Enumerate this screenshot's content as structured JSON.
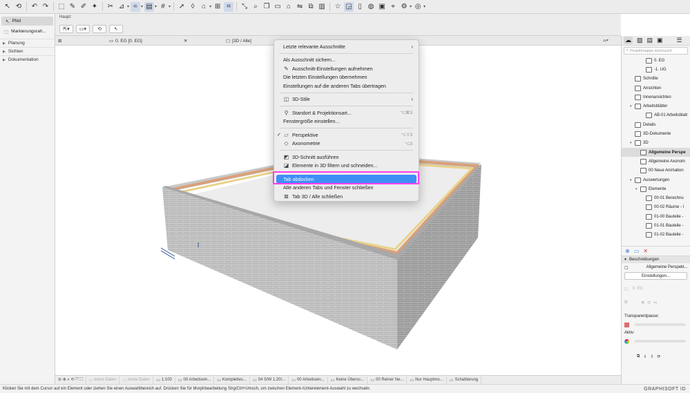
{
  "toolbar": {
    "colors": {
      "background": "#ececec",
      "active": "#cfd9ea"
    },
    "icons": [
      "undo-icon",
      "redo-icon",
      "arrow-tool-icon",
      "pen-icon",
      "magic-wand-icon",
      "scissors-icon",
      "measure-icon",
      "layer-icon",
      "grid-icon",
      "snap-icon",
      "cursor-icon",
      "lock-icon",
      "star-icon",
      "window-icon",
      "settings-icon"
    ]
  },
  "infobar": {
    "label": "Haupt:"
  },
  "left_panel": {
    "tools": [
      {
        "label": "Pfeil",
        "selected": true
      },
      {
        "label": "Markierungsrah...",
        "selected": false
      }
    ],
    "nav": [
      "Planung",
      "Sichten",
      "Dokumentation"
    ]
  },
  "tabs": {
    "tab1": "0. EG [0. EG]",
    "tab2": "[3D / Alle]"
  },
  "menu": {
    "items": {
      "letzte": "Letzte relevante Ausschnitte",
      "speichern": "Als Ausschnitt sichern...",
      "aufnehmen": "Ausschnitt-Einstellungen aufnehmen",
      "uebernehmen": "Die letzten Einstellungen übernehmen",
      "uebertragen": "Einstellungen auf die anderen Tabs übertragen",
      "stile": "3D-Stile",
      "standort": "Standort & Projektionsart...",
      "standort_sc": "⌥⌘3",
      "fenster": "Fenstergröße einstellen...",
      "perspektive": "Perspektive",
      "perspektive_sc": "⌥⇧3",
      "axonometrie": "Axonometrie",
      "axonometrie_sc": "⌥3",
      "schnitt": "3D-Schnitt ausführen",
      "filtern": "Elemente in 3D filtern und schneiden...",
      "abdocken": "Tab abdocken",
      "alle_schliessen": "Alle anderen Tabs und Fenster schließen",
      "tab_schliessen": "Tab 3D / Alle schließen"
    },
    "highlight_color": "#3e8ef7",
    "outline_color": "#ff3cf0"
  },
  "right_panel": {
    "search_placeholder": "Projektmappe durchsuch",
    "tree": [
      {
        "label": "0. EG",
        "indent": 3
      },
      {
        "label": "-1. UG",
        "indent": 3
      },
      {
        "label": "Schnitte",
        "indent": 1
      },
      {
        "label": "Ansichten",
        "indent": 1
      },
      {
        "label": "Innenansichten",
        "indent": 1
      },
      {
        "label": "Arbeitsblätter",
        "indent": 1,
        "expanded": true
      },
      {
        "label": "AB-01 Arbeitsblatt",
        "indent": 3
      },
      {
        "label": "Details",
        "indent": 1
      },
      {
        "label": "3D-Dokumente",
        "indent": 1
      },
      {
        "label": "3D",
        "indent": 1,
        "expanded": true
      },
      {
        "label": "Allgemeine Perspe",
        "indent": 2,
        "selected": true
      },
      {
        "label": "Allgemeine Axonom",
        "indent": 2
      },
      {
        "label": "00 Neue Animation",
        "indent": 2
      },
      {
        "label": "Auswertungen",
        "indent": 1,
        "expanded": true
      },
      {
        "label": "Elemente",
        "indent": 2,
        "expanded": true
      },
      {
        "label": "00-01 Berechnu",
        "indent": 3
      },
      {
        "label": "00-02 Räume - l",
        "indent": 3
      },
      {
        "label": "01-00 Bauteile -",
        "indent": 3
      },
      {
        "label": "01-01 Bauteile -",
        "indent": 3
      },
      {
        "label": "01-02 Bauteile -",
        "indent": 3
      }
    ],
    "beschreibungen": "Beschreibungen",
    "current_view": "Allgemeine Perspekt...",
    "einstellungen": "Einstellungen...",
    "eg_label": "0. EG",
    "transparent": "Transparentpause:",
    "aktiv": "Aktiv:"
  },
  "bottombar": {
    "items": [
      {
        "label": "keine Daten",
        "dim": true
      },
      {
        "label": "keine Daten",
        "dim": true
      },
      {
        "label": "1:100"
      },
      {
        "label": "00 Arbeitsein..."
      },
      {
        "label": "Komplettes..."
      },
      {
        "label": "04 S/W 1:20/..."
      },
      {
        "label": "00 Arbeitsein..."
      },
      {
        "label": "Keine Übersc..."
      },
      {
        "label": "00 Reiner Ne..."
      },
      {
        "label": "Nur Hauptmo..."
      },
      {
        "label": "Schattierung"
      }
    ]
  },
  "status": {
    "text": "Klicken Sie mit dem Cursor auf ein Element oder ziehen Sie einen Auswahlbereich auf. Drücken Sie für Morphbearbeitung Strg/Ctrl+Umsch, um zwischen Element-/Unterelement-Auswahl zu wechseln.",
    "brand": "GRAPHISOFT ID"
  },
  "scene": {
    "colors": {
      "brick": "#b9b9b9",
      "brick_dark": "#8f8f8f",
      "mortar": "#d8d8d8",
      "layer_orange": "#d9a07a",
      "layer_yellow": "#e8d28a",
      "cap": "#c9c9c9",
      "floor": "#ededed"
    }
  }
}
